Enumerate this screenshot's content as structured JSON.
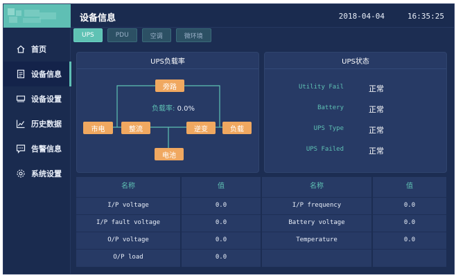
{
  "header": {
    "title": "设备信息",
    "date": "2018-04-04",
    "time": "16:35:25"
  },
  "sidebar": {
    "items": [
      {
        "label": "首页",
        "icon": "home-icon",
        "active": false
      },
      {
        "label": "设备信息",
        "icon": "list-icon",
        "active": true
      },
      {
        "label": "设备设置",
        "icon": "device-settings-icon",
        "active": false
      },
      {
        "label": "历史数据",
        "icon": "chart-line-icon",
        "active": false
      },
      {
        "label": "告警信息",
        "icon": "message-icon",
        "active": false
      },
      {
        "label": "系统设置",
        "icon": "gear-icon",
        "active": false
      }
    ]
  },
  "tabs": [
    {
      "label": "UPS",
      "active": true
    },
    {
      "label": "PDU",
      "active": false
    },
    {
      "label": "空调",
      "active": false
    },
    {
      "label": "微环境",
      "active": false
    }
  ],
  "load_panel": {
    "title": "UPS负载率",
    "load_label": "负载率:",
    "load_value": "0.0%",
    "nodes": {
      "bypass": "旁路",
      "mains": "市电",
      "rectifier": "整流",
      "inverter": "逆变",
      "load": "负载",
      "battery": "电池"
    }
  },
  "status_panel": {
    "title": "UPS状态",
    "rows": [
      {
        "key": "Utility Fail",
        "value": "正常"
      },
      {
        "key": "Battery",
        "value": "正常"
      },
      {
        "key": "UPS Type",
        "value": "正常"
      },
      {
        "key": "UPS Failed",
        "value": "正常"
      }
    ]
  },
  "table": {
    "name_header": "名称",
    "value_header": "值",
    "left": [
      {
        "name": "I/P voltage",
        "value": "0.0"
      },
      {
        "name": "I/P fault voltage",
        "value": "0.0"
      },
      {
        "name": "O/P voltage",
        "value": "0.0"
      },
      {
        "name": "O/P load",
        "value": "0.0"
      }
    ],
    "right": [
      {
        "name": "I/P frequency",
        "value": "0.0"
      },
      {
        "name": "Battery voltage",
        "value": "0.0"
      },
      {
        "name": "Temperature",
        "value": "0.0"
      },
      {
        "name": "",
        "value": ""
      }
    ]
  },
  "colors": {
    "accent": "#5fc2b4",
    "node": "#f0a860",
    "background": "#1c2d52",
    "panel": "#273a65"
  }
}
